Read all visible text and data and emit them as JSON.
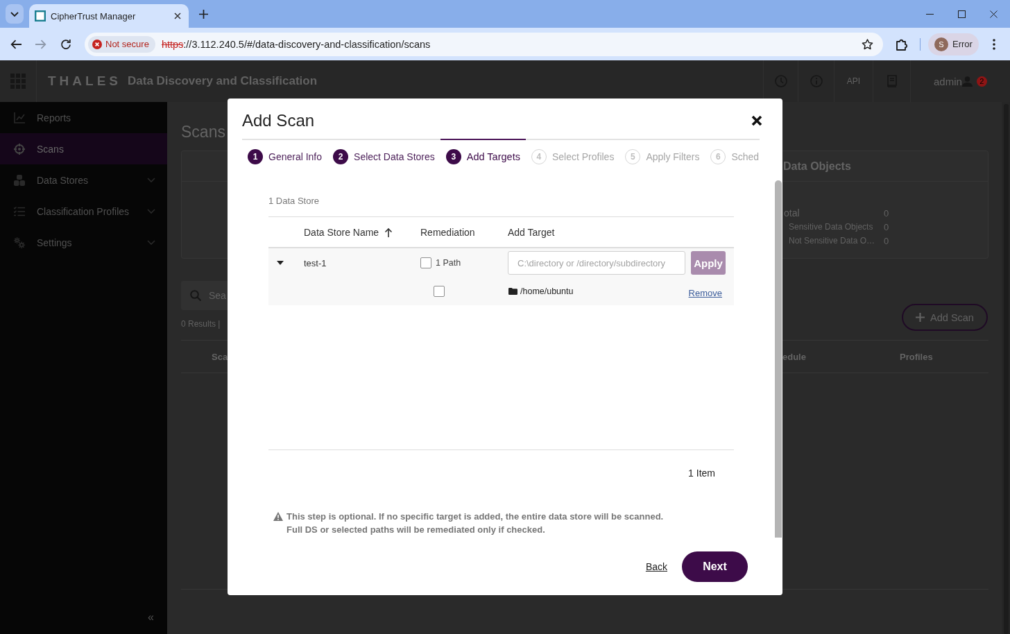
{
  "browser": {
    "tab_title": "CipherTrust Manager",
    "security_label": "Not secure",
    "url": {
      "scheme": "https",
      "rest": "://3.112.240.5/#/data-discovery-and-classification/scans"
    },
    "profile": {
      "initial": "S",
      "label": "Error"
    }
  },
  "app_header": {
    "logo": "THALES",
    "title": "Data Discovery and Classification",
    "api_label": "API",
    "user": "admin",
    "notification_count": "2"
  },
  "sidebar": {
    "items": [
      {
        "label": "Reports",
        "selected": false,
        "expandable": false
      },
      {
        "label": "Scans",
        "selected": true,
        "expandable": false
      },
      {
        "label": "Data Stores",
        "selected": false,
        "expandable": true
      },
      {
        "label": "Classification Profiles",
        "selected": false,
        "expandable": true
      },
      {
        "label": "Settings",
        "selected": false,
        "expandable": true
      }
    ],
    "collapse": "«"
  },
  "scans_page": {
    "title": "Scans",
    "search": {
      "placeholder": "Sea"
    },
    "results_summary": "0 Results |",
    "data_objects": {
      "title": "Data Objects",
      "rows": [
        {
          "kind": "total",
          "label": "otal",
          "value": "0"
        },
        {
          "kind": "legend",
          "label": "Sensitive Data Objects",
          "value": "0"
        },
        {
          "kind": "legend",
          "label": "Not Sensitive Data O…",
          "value": "0"
        }
      ]
    },
    "add_button": "Add Scan",
    "table": {
      "columns": [
        "Sca",
        "edule",
        "Profiles"
      ]
    }
  },
  "modal": {
    "title": "Add Scan",
    "steps": [
      {
        "number": "1",
        "label": "General Info",
        "completed": true,
        "selected": false
      },
      {
        "number": "2",
        "label": "Select Data Stores",
        "completed": true,
        "selected": false
      },
      {
        "number": "3",
        "label": "Add Targets",
        "completed": false,
        "selected": true
      },
      {
        "number": "4",
        "label": "Select Profiles",
        "completed": false,
        "selected": false
      },
      {
        "number": "5",
        "label": "Apply Filters",
        "completed": false,
        "selected": false
      },
      {
        "number": "6",
        "label": "Sched",
        "completed": false,
        "selected": false
      }
    ],
    "store_count": "1 Data Store",
    "table": {
      "columns": [
        {
          "label": "Data Store Name",
          "sorted": true
        },
        {
          "label": "Remediation",
          "sorted": false
        },
        {
          "label": "Add Target",
          "sorted": false
        }
      ],
      "rows": [
        {
          "name": "test-1",
          "expanded": true,
          "remediate": false,
          "path_count": "1 Path",
          "target_field": {
            "placeholder": "C:\\directory or /directory/subdirectory"
          },
          "apply": {
            "label": "Apply",
            "disabled": true
          },
          "paths": [
            {
              "path": "/home/ubuntu",
              "remediate": false,
              "remove": "Remove"
            }
          ]
        }
      ]
    },
    "item_count": "1 Item",
    "note": "This step is optional. If no specific target is added, the entire data store will be scanned.\nFull DS or selected paths will be remediated only if checked.",
    "back": "Back",
    "next": "Next"
  }
}
